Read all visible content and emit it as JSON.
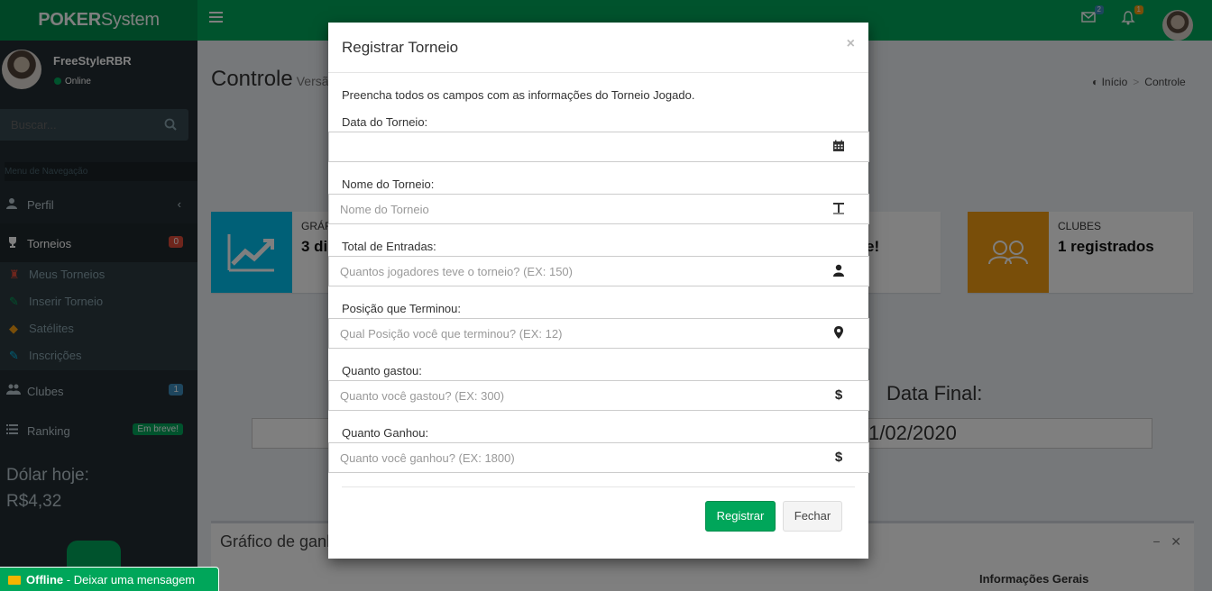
{
  "header": {
    "logo_bold": "POKER",
    "logo_light": "System",
    "mail_count": "2",
    "notif_count": "1",
    "colors": {
      "primary": "#00a65a",
      "primary_dark": "#008d4c",
      "sidebar": "#222d32"
    }
  },
  "sidebar": {
    "user_name": "FreeStyleRBR",
    "user_status": "Online",
    "search_placeholder": "Buscar...",
    "nav_header": "Menu de Navegação",
    "items": [
      {
        "label": "Perfil",
        "icon": "user-icon"
      },
      {
        "label": "Torneios",
        "icon": "trophy-icon",
        "badge": "0"
      },
      {
        "label": "Clubes",
        "icon": "users-icon",
        "badge": "1"
      },
      {
        "label": "Ranking",
        "icon": "list-icon",
        "badge": "Em breve!"
      }
    ],
    "submenu": [
      {
        "label": "Meus Torneios",
        "icon": "trophy-icon"
      },
      {
        "label": "Inserir Torneio",
        "icon": "edit-icon"
      },
      {
        "label": "Satélites",
        "icon": "ticket-icon"
      },
      {
        "label": "Inscrições",
        "icon": "edit-icon"
      }
    ],
    "dolar_label": "Dólar hoje:",
    "dolar_value": "R$4,32",
    "offline_status": "Offline",
    "offline_text": "- Deixar uma mensagem"
  },
  "content": {
    "title": "Controle",
    "subtitle": "Versã",
    "breadcrumb": [
      "Início",
      "Controle"
    ],
    "info_boxes": [
      {
        "label": "GRÁF",
        "value": "3 di"
      },
      {
        "label": "",
        "value": "e!"
      },
      {
        "label": "CLUBES",
        "value": "1 registrados"
      }
    ],
    "date_final_label": "Data Final:",
    "date_final_value": "1/02/2020",
    "chart_title": "Gráfico de ganh",
    "info_gerais": "Informações Gerais"
  },
  "modal": {
    "title": "Registrar Torneio",
    "close": "×",
    "intro": "Preencha todos os campos com as informações do Torneio Jogado.",
    "fields": [
      {
        "label": "Data do Torneio:",
        "placeholder": "",
        "icon": "calendar-icon"
      },
      {
        "label": "Nome do Torneio:",
        "placeholder": "Nome do Torneio",
        "icon": "text-icon"
      },
      {
        "label": "Total de Entradas:",
        "placeholder": "Quantos jogadores teve o torneio? (EX: 150)",
        "icon": "user-icon"
      },
      {
        "label": "Posição que Terminou:",
        "placeholder": "Qual Posição você que terminou? (EX: 12)",
        "icon": "map-marker-icon"
      },
      {
        "label": "Quanto gastou:",
        "placeholder": "Quanto você gastou? (EX: 300)",
        "icon": "dollar-icon"
      },
      {
        "label": "Quanto Ganhou:",
        "placeholder": "Quanto você ganhou? (EX: 1800)",
        "icon": "dollar-icon"
      }
    ],
    "submit_label": "Registrar",
    "cancel_label": "Fechar"
  }
}
